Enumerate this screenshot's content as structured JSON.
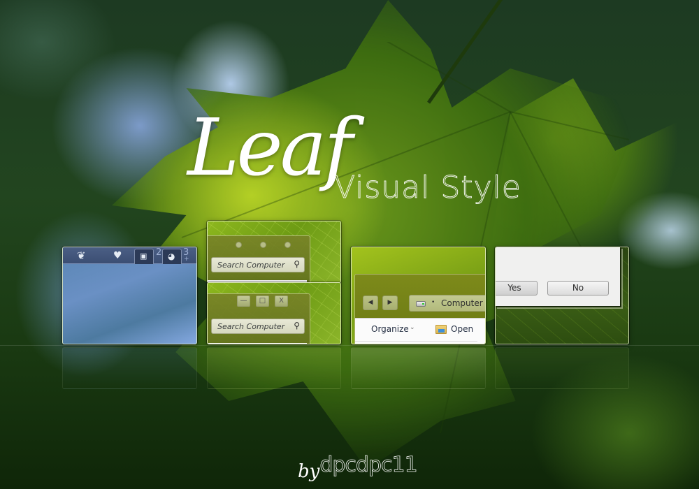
{
  "banner": {
    "title_script": "Leaf",
    "title_outline": "Visual Style",
    "byline_prefix": "by",
    "author": "dpcdpc11"
  },
  "previews": {
    "taskbar": {
      "icons": [
        "leaf-logo-icon",
        "fox-icon",
        "finder-icon",
        "firefox-icon"
      ],
      "desktop_numbers": [
        "2",
        "3"
      ],
      "add_desktop": "+"
    },
    "search_window_dots": {
      "caption_buttons": [
        "dot-1",
        "dot-2",
        "dot-3"
      ],
      "search_placeholder": "Search Computer"
    },
    "search_window_classic": {
      "caption_buttons": {
        "minimize": "—",
        "maximize": "□",
        "close": "X"
      },
      "search_placeholder": "Search Computer"
    },
    "explorer": {
      "back": "◀",
      "forward": "▶",
      "address_separator": "•",
      "address_crumb": "Computer",
      "organize_label": "Organize",
      "organize_chevron": "⌄",
      "open_label": "Open"
    },
    "dialog": {
      "yes_label": "Yes",
      "no_label": "No"
    }
  },
  "colors": {
    "leaf_green": "#6f9c1b",
    "taskbar_blue": "#3b4e73",
    "olive_window": "#6a7814",
    "dialog_bg": "#f0f0ef"
  }
}
